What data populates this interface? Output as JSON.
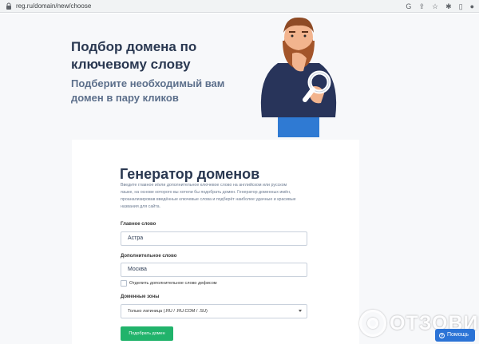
{
  "browser": {
    "url": "reg.ru/domain/new/choose",
    "icons": [
      "google-icon",
      "share-icon",
      "star-icon",
      "extensions-icon",
      "reading-list-icon",
      "profile-icon"
    ]
  },
  "hero": {
    "title": "Подбор домена по ключевому слову",
    "subtitle": "Подберите необходимый вам домен в пару кликов"
  },
  "generator": {
    "title": "Генератор доменов",
    "description": "Введите главное и/или дополнительное ключевое слово на английском или русском языке, на основе которого вы хотели бы подобрать домен. Генератор доменных имён, проанализировав введённые ключевые слова и подберёт наиболее удачные и красивые названия для сайта.",
    "main_word_label": "Главное слово",
    "main_word_value": "Астра",
    "extra_word_label": "Дополнительное слово",
    "extra_word_value": "Москва",
    "hyphen_checkbox_label": "Отделить дополнительное слово дефисом",
    "hyphen_checked": false,
    "zones_label": "Доменные зоны",
    "zones_selected": "Только латиница (.RU / .RU.COM / .SU)",
    "submit_label": "Подобрать домен"
  },
  "watermark": {
    "text": "ОТЗОВИК"
  },
  "help": {
    "label": "Помощь"
  },
  "colors": {
    "accent_green": "#21b36b",
    "help_blue": "#2b73d6",
    "heading": "#2a3851"
  }
}
